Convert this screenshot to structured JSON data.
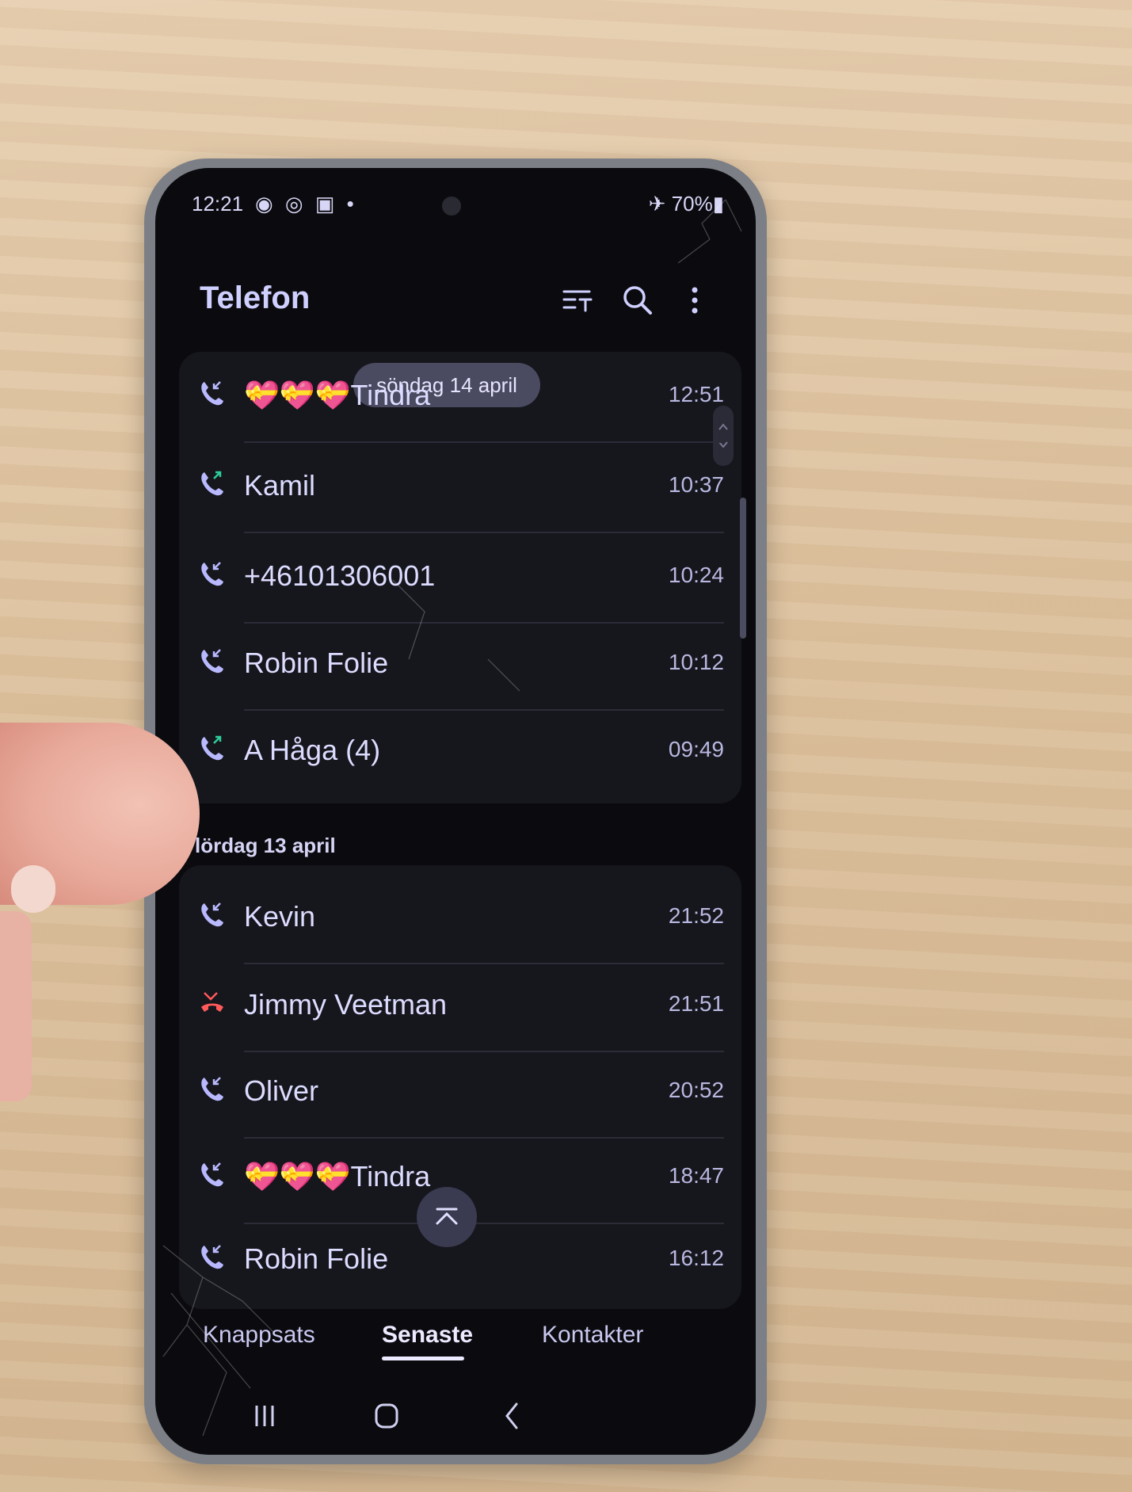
{
  "status_bar": {
    "time": "12:21",
    "left_icons": "◉ ◎ ▣ •",
    "battery": "✈ 70%▮"
  },
  "app": {
    "title": "Telefon"
  },
  "sections": [
    {
      "date": "söndag 14 april",
      "calls": [
        {
          "name": "Tindra",
          "prefix_emoji": "💝💝💝",
          "time": "12:51",
          "type": "incoming"
        },
        {
          "name": "Kamil",
          "time": "10:37",
          "type": "outgoing"
        },
        {
          "name": "+46101306001",
          "time": "10:24",
          "type": "incoming"
        },
        {
          "name": "Robin Folie",
          "time": "10:12",
          "type": "incoming"
        },
        {
          "name": "A Håga (4)",
          "time": "09:49",
          "type": "outgoing"
        }
      ]
    },
    {
      "date": "lördag 13 april",
      "calls": [
        {
          "name": "Kevin",
          "time": "21:52",
          "type": "incoming"
        },
        {
          "name": "Jimmy Veetman",
          "time": "21:51",
          "type": "missed"
        },
        {
          "name": "Oliver",
          "time": "20:52",
          "type": "incoming"
        },
        {
          "name": "Tindra",
          "prefix_emoji": "💝💝💝",
          "time": "18:47",
          "type": "incoming"
        },
        {
          "name": "Robin Folie",
          "time": "16:12",
          "type": "incoming"
        }
      ]
    }
  ],
  "tabs": {
    "keypad": "Knappsats",
    "recent": "Senaste",
    "contacts": "Kontakter",
    "active": "recent"
  },
  "colors": {
    "incoming_icon": "#b9b9ff",
    "outgoing_arrow": "#2ecc9a",
    "missed_icon": "#ff5a5a",
    "accent": "#cfd0ff"
  }
}
